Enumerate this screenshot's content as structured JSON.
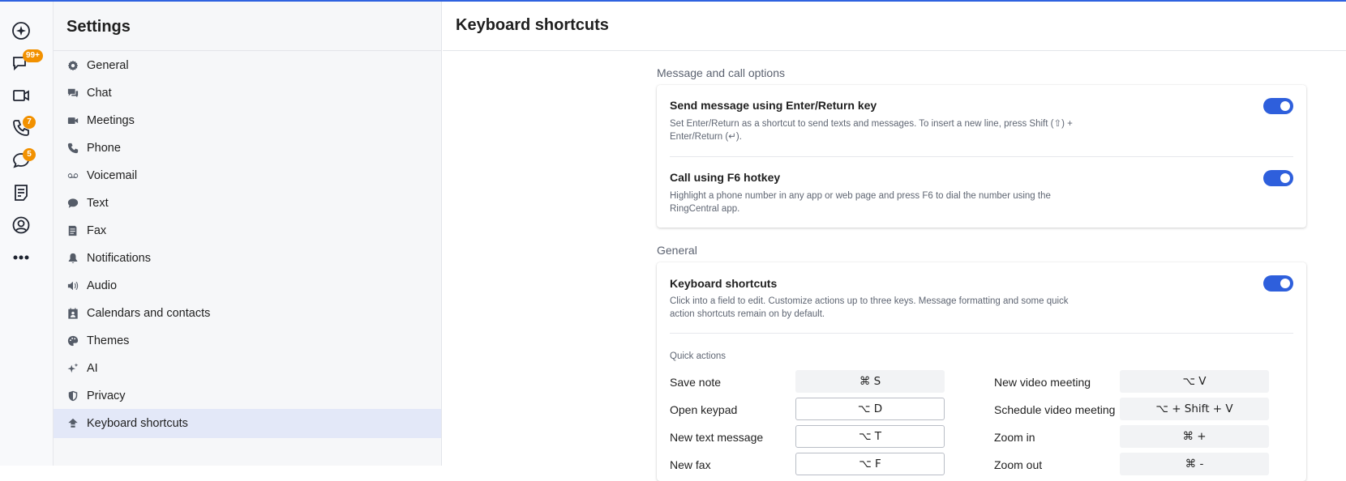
{
  "rail": {
    "chat_badge": "99+",
    "phone_badge": "7",
    "text_badge": "5",
    "items": [
      "spark-icon",
      "chat-icon",
      "video-icon",
      "phone-icon",
      "message-icon",
      "notes-icon",
      "contacts-icon",
      "more-icon"
    ]
  },
  "sidebar": {
    "title": "Settings",
    "items": [
      {
        "label": "General",
        "icon": "gear-icon"
      },
      {
        "label": "Chat",
        "icon": "chat-icon"
      },
      {
        "label": "Meetings",
        "icon": "video-icon"
      },
      {
        "label": "Phone",
        "icon": "phone-icon"
      },
      {
        "label": "Voicemail",
        "icon": "voicemail-icon"
      },
      {
        "label": "Text",
        "icon": "text-bubble-icon"
      },
      {
        "label": "Fax",
        "icon": "fax-icon"
      },
      {
        "label": "Notifications",
        "icon": "bell-icon"
      },
      {
        "label": "Audio",
        "icon": "speaker-icon"
      },
      {
        "label": "Calendars and contacts",
        "icon": "calendar-contact-icon"
      },
      {
        "label": "Themes",
        "icon": "palette-icon"
      },
      {
        "label": "AI",
        "icon": "sparkle-icon"
      },
      {
        "label": "Privacy",
        "icon": "shield-icon"
      },
      {
        "label": "Keyboard shortcuts",
        "icon": "keyboard-icon"
      }
    ],
    "active": "Keyboard shortcuts"
  },
  "main": {
    "title": "Keyboard shortcuts",
    "section1": {
      "label": "Message and call options",
      "rows": [
        {
          "title": "Send message using Enter/Return key",
          "desc": "Set Enter/Return as a shortcut to send texts and messages. To insert a new line, press Shift (⇧) + Enter/Return (↵).",
          "enabled": true
        },
        {
          "title": "Call using F6 hotkey",
          "desc": "Highlight a phone number in any app or web page and press F6 to dial the number using the RingCentral app.",
          "enabled": true
        }
      ]
    },
    "section2": {
      "label": "General",
      "row": {
        "title": "Keyboard shortcuts",
        "desc": "Click into a field to edit. Customize actions up to three keys. Message formatting and some quick action shortcuts remain on by default.",
        "enabled": true
      },
      "quick_actions_label": "Quick actions",
      "left": [
        {
          "label": "Save note",
          "keys": "⌘ S",
          "editable": false
        },
        {
          "label": "Open keypad",
          "keys": "⌥ D",
          "editable": true
        },
        {
          "label": "New text message",
          "keys": "⌥ T",
          "editable": true
        },
        {
          "label": "New fax",
          "keys": "⌥ F",
          "editable": true
        }
      ],
      "right": [
        {
          "label": "New video meeting",
          "keys": "⌥ V",
          "editable": false
        },
        {
          "label": "Schedule video meeting",
          "keys": "⌥ + Shift + V",
          "editable": false
        },
        {
          "label": "Zoom in",
          "keys": "⌘ +",
          "editable": false
        },
        {
          "label": "Zoom out",
          "keys": "⌘ -",
          "editable": false
        }
      ]
    }
  },
  "colors": {
    "accent": "#2e5fdc",
    "badge": "#f29100",
    "active_nav": "#e3e8f8"
  }
}
